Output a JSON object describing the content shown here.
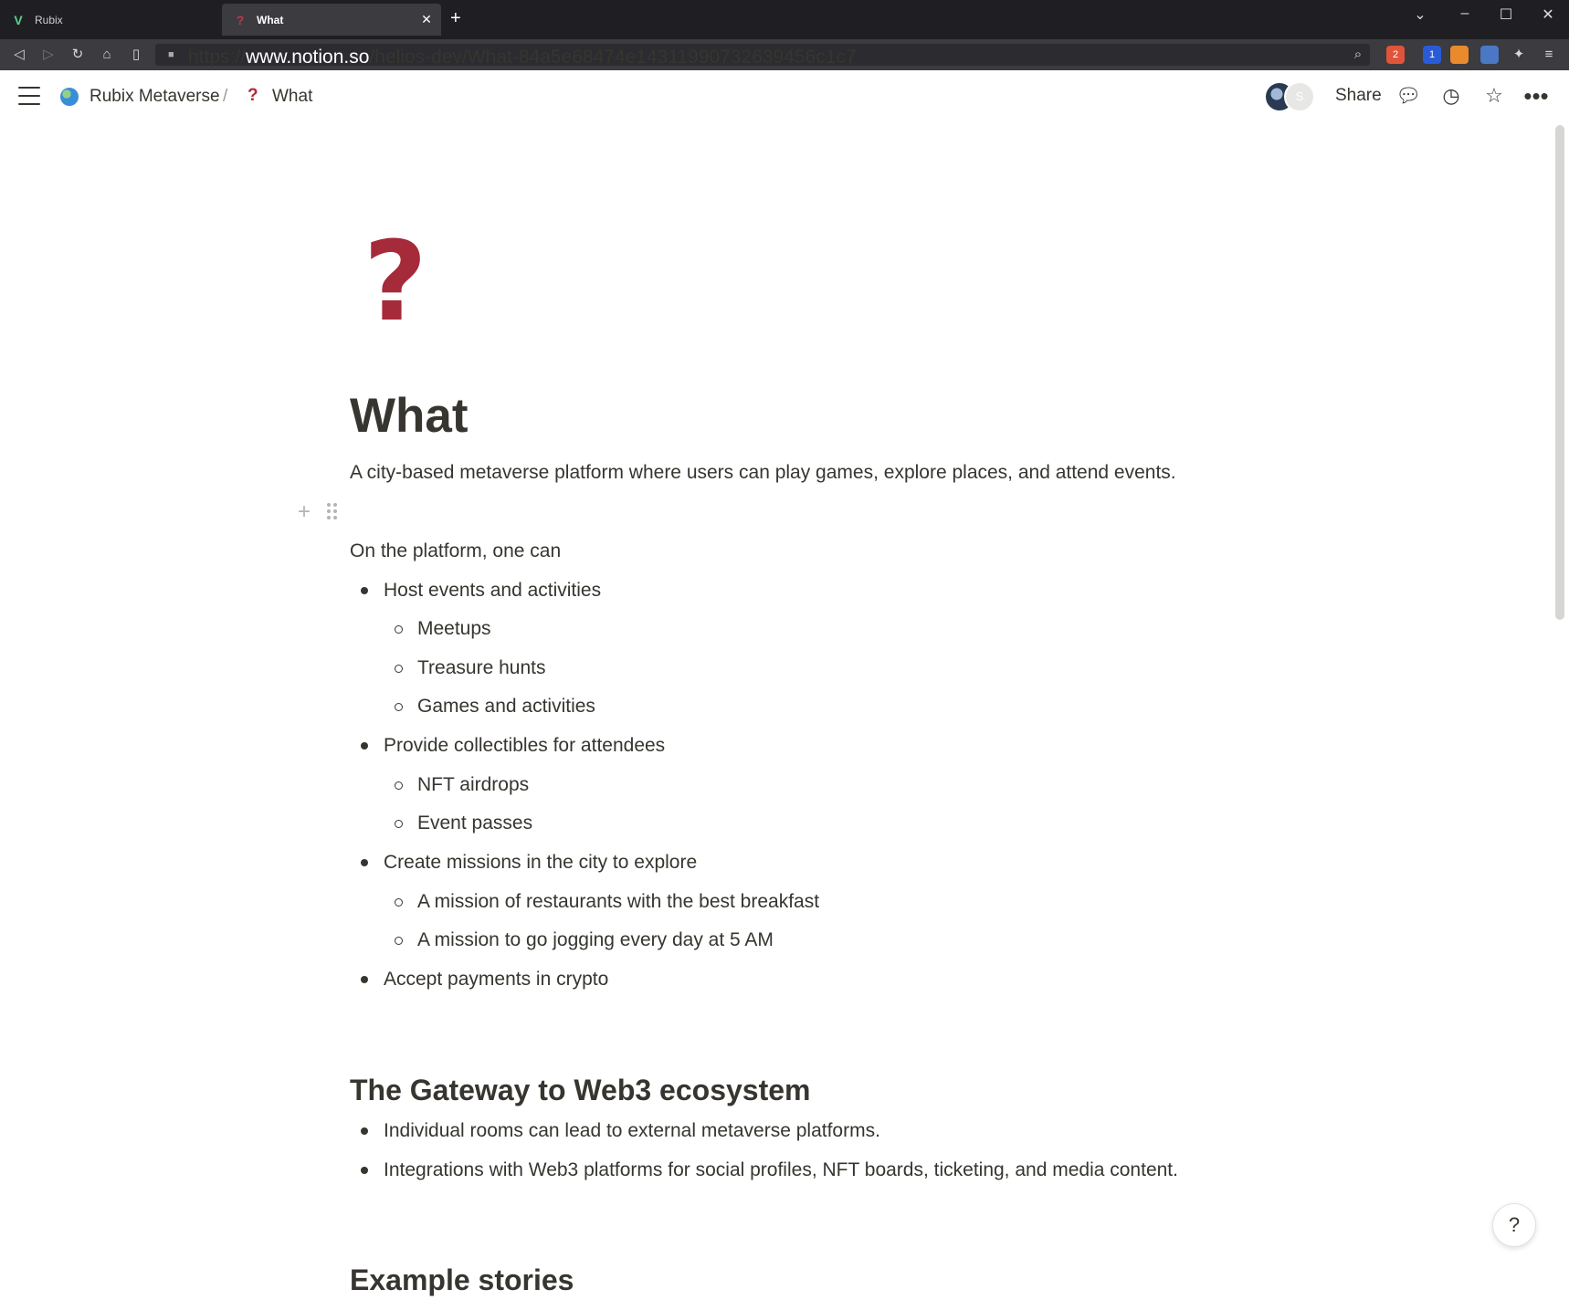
{
  "browser": {
    "tabs": [
      {
        "title": "Rubix",
        "active": false,
        "icon": "vivaldi-v-icon"
      },
      {
        "title": "What",
        "active": true,
        "icon": "red-question-icon"
      }
    ],
    "url_scheme": "https://",
    "url_host": "www.notion.so",
    "url_path": "/helios-dev/What-84a5e68474e14311990732639456c1c7",
    "brave_badge": "2",
    "ext_badge": "1"
  },
  "topbar": {
    "breadcrumb": [
      {
        "label": "Rubix Metaverse",
        "icon": "globe-icon"
      },
      {
        "label": "What",
        "icon": "question-icon"
      }
    ],
    "breadcrumb_separator": "/",
    "share_label": "Share",
    "second_avatar_initial": "S"
  },
  "page": {
    "icon": "?",
    "title": "What",
    "subtitle": "A city-based metaverse platform where users can play games, explore places, and attend events.",
    "intro": "On the platform, one can",
    "list": [
      {
        "text": "Host events and activities",
        "children": [
          "Meetups",
          "Treasure hunts",
          "Games and activities"
        ]
      },
      {
        "text": "Provide collectibles for attendees",
        "children": [
          "NFT airdrops",
          "Event passes"
        ]
      },
      {
        "text": "Create missions in the city to explore",
        "children": [
          "A mission of restaurants with the best breakfast",
          "A mission to go jogging every day at 5 AM"
        ]
      },
      {
        "text": "Accept payments in crypto",
        "children": []
      }
    ],
    "section1": {
      "heading": "The Gateway to Web3 ecosystem",
      "items": [
        "Individual rooms can lead to external metaverse platforms.",
        "Integrations with Web3 platforms for social profiles, NFT boards, ticketing, and media content."
      ]
    },
    "section2_heading": "Example stories"
  },
  "help_label": "?",
  "colors": {
    "text": "#37352f",
    "icon_red": "#a52a3a",
    "chrome_dark": "#1f1f23"
  }
}
